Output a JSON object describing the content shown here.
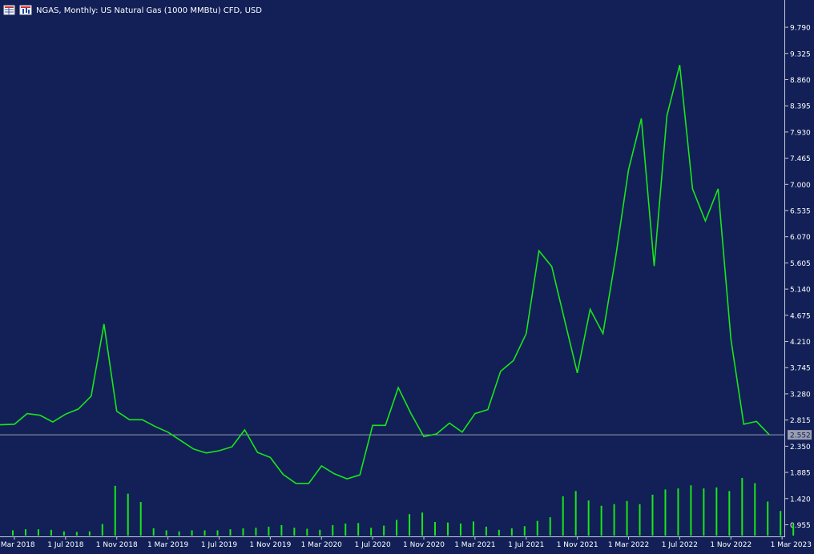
{
  "header": {
    "title": "NGAS, Monthly:  US Natural Gas (1000 MMBtu) CFD, USD"
  },
  "icons": [
    "table-icon",
    "chart-type-icon"
  ],
  "colors": {
    "background": "#122057",
    "price_line": "#19E619",
    "volume_bars": "#19E619",
    "axis": "#C8CCDA",
    "text": "#FFFFFF",
    "current_price_label_bg": "#9A9EAE"
  },
  "price_axis": {
    "ticks": [
      "9.790",
      "9.325",
      "8.860",
      "8.395",
      "7.930",
      "7.465",
      "7.000",
      "6.535",
      "6.070",
      "5.605",
      "5.140",
      "4.675",
      "4.210",
      "3.745",
      "3.280",
      "2.815",
      "2.350",
      "1.885",
      "1.420",
      "0.955"
    ],
    "current_price_label": "2.552"
  },
  "time_axis": {
    "ticks": [
      "1 Mar 2018",
      "1 Jul 2018",
      "1 Nov 2018",
      "1 Mar 2019",
      "1 Jul 2019",
      "1 Nov 2019",
      "1 Mar 2020",
      "1 Jul 2020",
      "1 Nov 2020",
      "1 Mar 2021",
      "1 Jul 2021",
      "1 Nov 2021",
      "1 Mar 2022",
      "1 Jul 2022",
      "1 Nov 2022",
      "1 Mar 2023"
    ]
  },
  "chart_data": {
    "type": "line",
    "x_start": "2018-02",
    "interval": "monthly",
    "ylim": [
      0.72,
      9.99
    ],
    "grid": false,
    "current_price": 2.552,
    "series": [
      {
        "values": [
          2.73,
          2.74,
          2.93,
          2.9,
          2.78,
          2.92,
          3.01,
          3.24,
          4.52,
          2.97,
          2.82,
          2.82,
          2.7,
          2.6,
          2.45,
          2.3,
          2.23,
          2.27,
          2.34,
          2.64,
          2.24,
          2.15,
          1.85,
          1.69,
          1.69,
          2.0,
          1.86,
          1.77,
          1.84,
          2.72,
          2.72,
          3.39,
          2.93,
          2.52,
          2.57,
          2.76,
          2.6,
          2.93,
          3.0,
          3.68,
          3.87,
          4.35,
          5.82,
          5.54,
          4.59,
          3.65,
          4.78,
          4.35,
          5.72,
          7.26,
          8.17,
          5.55,
          8.22,
          9.12,
          6.92,
          6.35,
          6.92,
          4.25,
          2.74,
          2.79,
          2.552
        ]
      }
    ],
    "volume": {
      "ylim": [
        0,
        1.1
      ],
      "values": [
        0.1,
        0.12,
        0.12,
        0.11,
        0.08,
        0.07,
        0.08,
        0.22,
        0.95,
        0.8,
        0.64,
        0.14,
        0.1,
        0.08,
        0.1,
        0.1,
        0.1,
        0.12,
        0.14,
        0.15,
        0.17,
        0.2,
        0.15,
        0.13,
        0.11,
        0.2,
        0.23,
        0.24,
        0.15,
        0.19,
        0.3,
        0.41,
        0.44,
        0.26,
        0.25,
        0.23,
        0.27,
        0.17,
        0.11,
        0.14,
        0.18,
        0.28,
        0.35,
        0.75,
        0.85,
        0.67,
        0.57,
        0.6,
        0.66,
        0.6,
        0.78,
        0.88,
        0.9,
        0.96,
        0.9,
        0.92,
        0.85,
        1.1,
        1.0,
        0.65,
        0.47,
        0.22
      ]
    }
  }
}
